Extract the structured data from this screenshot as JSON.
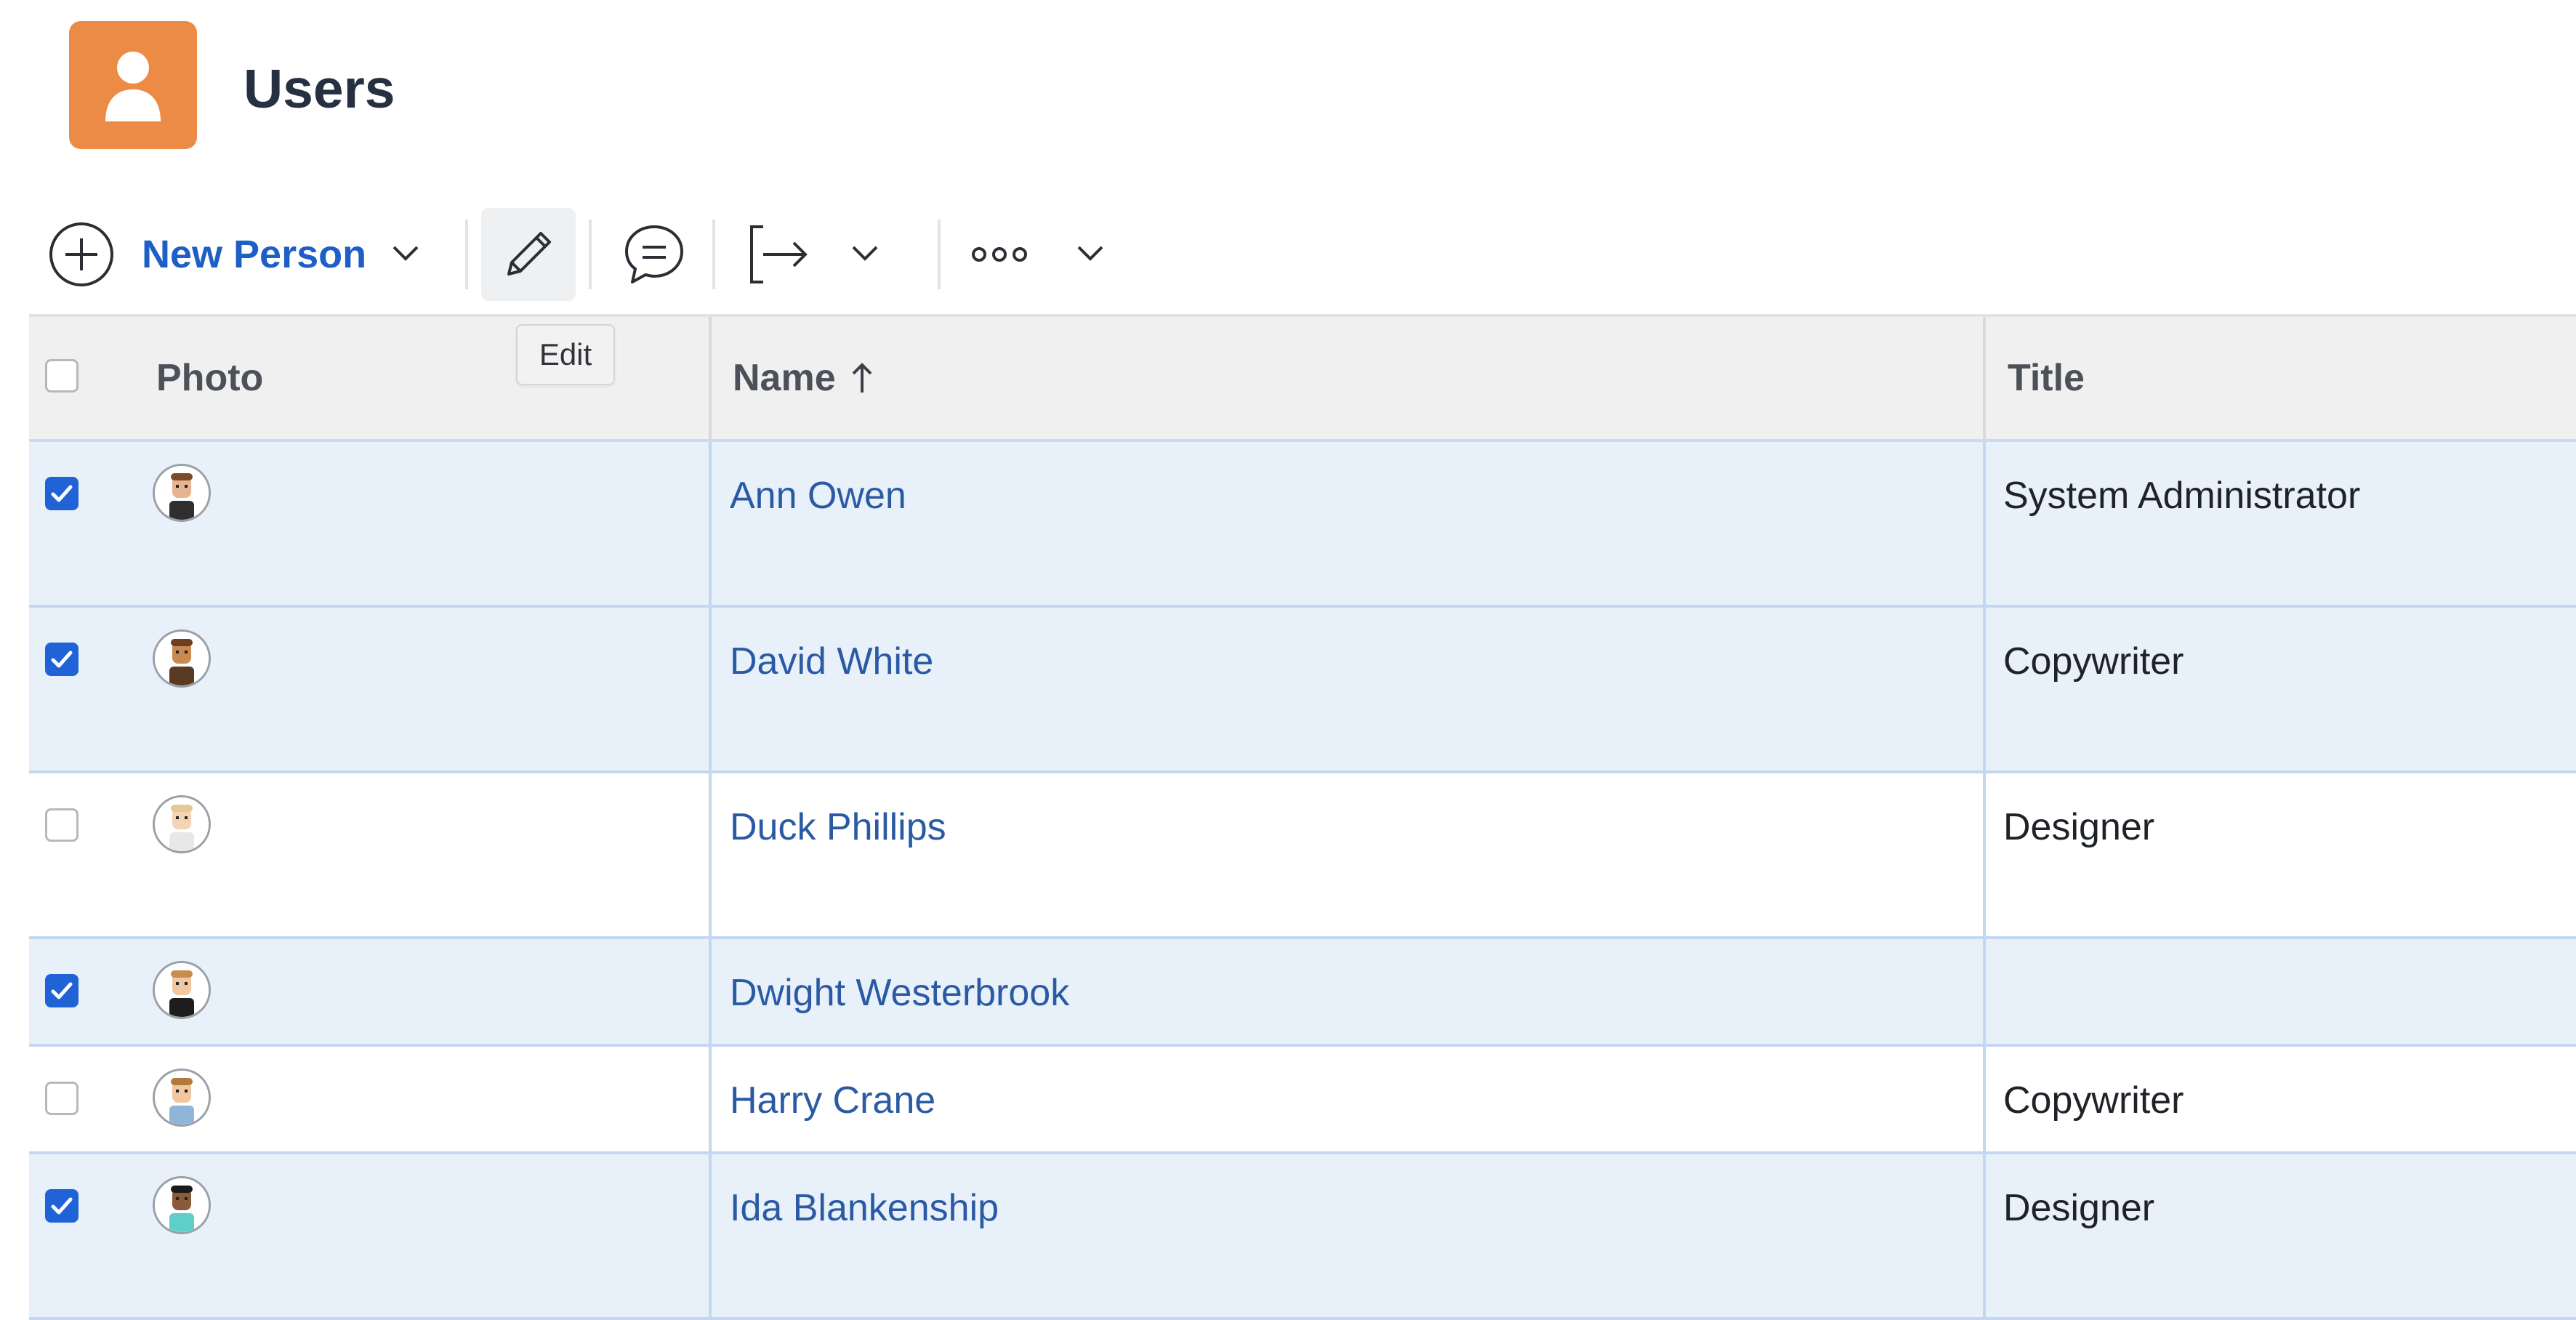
{
  "header": {
    "app_icon": "user-icon",
    "title": "Users",
    "accent_color": "#ec8b45"
  },
  "toolbar": {
    "add_icon": "plus-circle-icon",
    "new_person_label": "New Person",
    "edit_icon": "pencil-icon",
    "comment_icon": "comment-icon",
    "export_icon": "export-icon",
    "more_icon": "more-dots-icon",
    "edit_tooltip": "Edit"
  },
  "table": {
    "columns": {
      "photo": "Photo",
      "name": "Name",
      "title": "Title"
    },
    "sort": {
      "column": "name",
      "direction": "ascending",
      "indicator_icon": "arrow-up-icon"
    },
    "rows": [
      {
        "selected": true,
        "name": "Ann Owen",
        "title": "System Administrator"
      },
      {
        "selected": true,
        "name": "David White",
        "title": "Copywriter"
      },
      {
        "selected": false,
        "name": "Duck Phillips",
        "title": "Designer"
      },
      {
        "selected": true,
        "name": "Dwight Westerbrook",
        "title": ""
      },
      {
        "selected": false,
        "name": "Harry Crane",
        "title": "Copywriter"
      },
      {
        "selected": true,
        "name": "Ida Blankenship",
        "title": "Designer"
      }
    ]
  },
  "colors": {
    "link": "#2a5aa3",
    "primary": "#1d5fc7",
    "selected_row": "#e8f0fa",
    "checkbox_checked": "#1f63d6"
  }
}
